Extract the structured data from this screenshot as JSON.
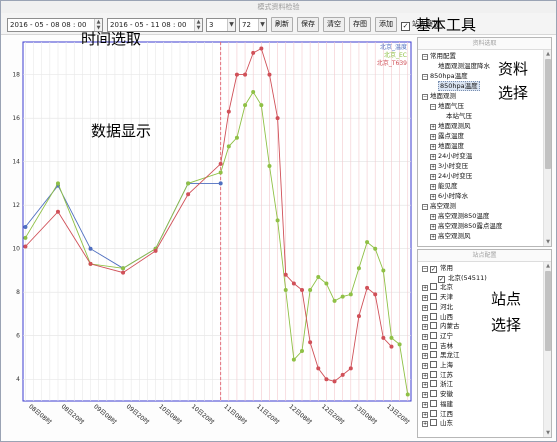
{
  "window": {
    "title": "模式资料检验"
  },
  "toolbar": {
    "start_date": "2016 - 05 - 08   08 : 00",
    "end_date": "2016 - 05 - 11   08 : 00",
    "step": "3",
    "range": "72",
    "buttons": {
      "refresh": "刷新",
      "save": "保存",
      "clear": "清空",
      "save_image": "存图",
      "add": "添加"
    },
    "overlay_label": "站点叠加",
    "overlay_checked": true
  },
  "annotations": {
    "time_select": "时间选取",
    "data_display": "数据显示",
    "basic_tools": "基本工具",
    "data_choice_line1": "资料",
    "data_choice_line2": "选择",
    "station_line1": "站点",
    "station_line2": "选择"
  },
  "data_panel": {
    "header": "资料选取",
    "items": [
      {
        "label": "常用配置",
        "level": 0,
        "expander": "−"
      },
      {
        "label": "地面观测温度降水",
        "level": 1,
        "expander": ""
      },
      {
        "label": "850hpa温度",
        "level": 0,
        "expander": "−"
      },
      {
        "label": "850hpa温度",
        "level": 1,
        "expander": "",
        "selected": true
      },
      {
        "label": "地面观测",
        "level": 0,
        "expander": "−"
      },
      {
        "label": "地面气压",
        "level": 1,
        "expander": "−"
      },
      {
        "label": "本站气压",
        "level": 2,
        "expander": ""
      },
      {
        "label": "地面观测风",
        "level": 1,
        "expander": "+"
      },
      {
        "label": "露点温度",
        "level": 1,
        "expander": "+"
      },
      {
        "label": "地面温度",
        "level": 1,
        "expander": "+"
      },
      {
        "label": "24小时变温",
        "level": 1,
        "expander": "+"
      },
      {
        "label": "3小时变压",
        "level": 1,
        "expander": "+"
      },
      {
        "label": "24小时变压",
        "level": 1,
        "expander": "+"
      },
      {
        "label": "能见度",
        "level": 1,
        "expander": "+"
      },
      {
        "label": "6小时降水",
        "level": 1,
        "expander": "+"
      },
      {
        "label": "高空观测",
        "level": 0,
        "expander": "−"
      },
      {
        "label": "高空观测850温度",
        "level": 1,
        "expander": "+"
      },
      {
        "label": "高空观测850露点温度",
        "level": 1,
        "expander": "+"
      },
      {
        "label": "高空观测风",
        "level": 1,
        "expander": "+"
      }
    ]
  },
  "station_panel": {
    "header": "站点配置",
    "items": [
      {
        "label": "常用",
        "level": 0,
        "expander": "−",
        "checked": true
      },
      {
        "label": "北京(54511)",
        "level": 1,
        "expander": "",
        "checked": true
      },
      {
        "label": "北京",
        "level": 0,
        "expander": "+",
        "checked": false
      },
      {
        "label": "天津",
        "level": 0,
        "expander": "+",
        "checked": false
      },
      {
        "label": "河北",
        "level": 0,
        "expander": "+",
        "checked": false
      },
      {
        "label": "山西",
        "level": 0,
        "expander": "+",
        "checked": false
      },
      {
        "label": "内蒙古",
        "level": 0,
        "expander": "+",
        "checked": false
      },
      {
        "label": "辽宁",
        "level": 0,
        "expander": "+",
        "checked": false
      },
      {
        "label": "吉林",
        "level": 0,
        "expander": "+",
        "checked": false
      },
      {
        "label": "黑龙江",
        "level": 0,
        "expander": "+",
        "checked": false
      },
      {
        "label": "上海",
        "level": 0,
        "expander": "+",
        "checked": false
      },
      {
        "label": "江苏",
        "level": 0,
        "expander": "+",
        "checked": false
      },
      {
        "label": "浙江",
        "level": 0,
        "expander": "+",
        "checked": false
      },
      {
        "label": "安徽",
        "level": 0,
        "expander": "+",
        "checked": false
      },
      {
        "label": "福建",
        "level": 0,
        "expander": "+",
        "checked": false
      },
      {
        "label": "江西",
        "level": 0,
        "expander": "+",
        "checked": false
      },
      {
        "label": "山东",
        "level": 0,
        "expander": "+",
        "checked": false
      }
    ]
  },
  "chart_data": {
    "type": "line",
    "title": "",
    "xlabel": "",
    "ylabel": "",
    "ylim": [
      3,
      19.5
    ],
    "xlim": [
      0,
      42
    ],
    "yticks": [
      4,
      6,
      8,
      10,
      12,
      14,
      16,
      18
    ],
    "xticks": [
      {
        "x": 0,
        "label": "08日08时"
      },
      {
        "x": 4,
        "label": "08日20时"
      },
      {
        "x": 8,
        "label": "09日08时"
      },
      {
        "x": 12,
        "label": "09日20时"
      },
      {
        "x": 16,
        "label": "10日08时"
      },
      {
        "x": 20,
        "label": "10日20时"
      },
      {
        "x": 24,
        "label": "11日08时"
      },
      {
        "x": 28,
        "label": "11日20时"
      },
      {
        "x": 32,
        "label": "12日08时"
      },
      {
        "x": 36,
        "label": "12日20时"
      },
      {
        "x": 40,
        "label": "13日08时"
      },
      {
        "x": 44,
        "label": "13日20时"
      }
    ],
    "divider_x": 24,
    "forecast_start_x": 24,
    "forecast_step": 1,
    "grid": true,
    "legend_position": "top-right",
    "series": [
      {
        "name": "北京_温度",
        "color": "#4f6fc0",
        "points": [
          [
            0,
            11
          ],
          [
            4,
            12.9
          ],
          [
            8,
            10
          ],
          [
            12,
            9.1
          ],
          [
            16,
            10
          ],
          [
            20,
            13
          ],
          [
            24,
            13
          ]
        ]
      },
      {
        "name": "北京_EC",
        "color": "#8fc045",
        "points": [
          [
            0,
            10.5
          ],
          [
            4,
            13
          ],
          [
            8,
            9.3
          ],
          [
            12,
            9.1
          ],
          [
            16,
            10
          ],
          [
            20,
            13
          ],
          [
            24,
            13.5
          ],
          [
            25,
            14.7
          ],
          [
            26,
            15.1
          ],
          [
            27,
            16.6
          ],
          [
            28,
            17.2
          ],
          [
            29,
            16.6
          ],
          [
            30,
            13.8
          ],
          [
            31,
            11.3
          ],
          [
            32,
            8.1
          ],
          [
            33,
            4.9
          ],
          [
            34,
            5.3
          ],
          [
            35,
            8.1
          ],
          [
            36,
            8.7
          ],
          [
            37,
            8.4
          ],
          [
            38,
            7.6
          ],
          [
            39,
            7.8
          ],
          [
            40,
            7.9
          ],
          [
            41,
            9.1
          ],
          [
            42,
            10.3
          ],
          [
            43,
            10
          ],
          [
            44,
            9
          ],
          [
            45,
            5.9
          ],
          [
            46,
            5.6
          ],
          [
            47,
            3.3
          ]
        ]
      },
      {
        "name": "北京_T639",
        "color": "#d05058",
        "points": [
          [
            0,
            10.1
          ],
          [
            4,
            11.7
          ],
          [
            8,
            9.3
          ],
          [
            12,
            8.9
          ],
          [
            16,
            9.9
          ],
          [
            20,
            12.5
          ],
          [
            24,
            13.9
          ],
          [
            25,
            16.3
          ],
          [
            26,
            18
          ],
          [
            27,
            18
          ],
          [
            28,
            19
          ],
          [
            29,
            19.2
          ],
          [
            30,
            18
          ],
          [
            31,
            16
          ],
          [
            32,
            8.8
          ],
          [
            33,
            8.4
          ],
          [
            34,
            8.1
          ],
          [
            35,
            5.7
          ],
          [
            36,
            4.5
          ],
          [
            37,
            4
          ],
          [
            38,
            3.9
          ],
          [
            39,
            4.2
          ],
          [
            40,
            4.5
          ],
          [
            41,
            6.9
          ],
          [
            42,
            8.2
          ],
          [
            43,
            7.9
          ],
          [
            44,
            5.9
          ],
          [
            45,
            5.5
          ]
        ]
      }
    ]
  }
}
